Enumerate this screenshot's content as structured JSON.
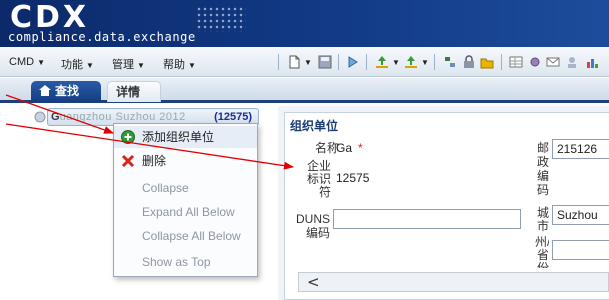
{
  "logo": {
    "main": "CDX",
    "tagline": "compliance.data.exchange"
  },
  "menubar": {
    "items": [
      "CMD",
      "功能",
      "管理",
      "帮助"
    ]
  },
  "tabs": {
    "search": "查找",
    "detail": "详情"
  },
  "tree": {
    "node_prefix": "G",
    "node_blurred": "uangzhou Suzhou 2012",
    "node_id": "(12575)"
  },
  "context_menu": {
    "items": [
      {
        "label": "添加组织单位",
        "icon": "plus-circle-icon",
        "enabled": true
      },
      {
        "label": "删除",
        "icon": "red-x-icon",
        "enabled": true
      },
      {
        "label": "Collapse",
        "enabled": false
      },
      {
        "label": "Expand All Below",
        "enabled": false
      },
      {
        "label": "Collapse All Below",
        "enabled": false
      },
      {
        "label": "Show as Top",
        "enabled": false
      }
    ]
  },
  "form": {
    "section_title": "组织单位",
    "name_label": "名称",
    "name_value": "Ga",
    "required_mark": "*",
    "enterprise_id_label": "企业标识符",
    "enterprise_id_value": "12575",
    "duns_label": "DUNS编码",
    "duns_value": "",
    "postal_label": "邮政编码",
    "postal_value": "215126",
    "city_label": "城市",
    "city_value": "Suzhou",
    "state_label": "州/省份",
    "state_value": ""
  },
  "scroll": {
    "left_arrow": "<"
  },
  "colors": {
    "header_blue": "#123a86",
    "tab_active": "#1d4a92",
    "annotation_red": "#e00000",
    "section_title": "#1b3b74"
  }
}
